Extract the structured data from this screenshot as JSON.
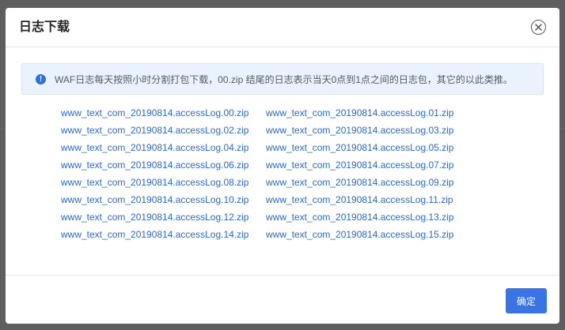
{
  "dialog": {
    "title": "日志下载",
    "close_icon": "close-circle-icon",
    "notice": {
      "icon": "info-icon",
      "icon_glyph": "!",
      "text": "WAF日志每天按照小时分割打包下载，00.zip 结尾的日志表示当天0点到1点之间的日志包，其它的以此类推。"
    },
    "files": [
      "www_text_com_20190814.accessLog.00.zip",
      "www_text_com_20190814.accessLog.01.zip",
      "www_text_com_20190814.accessLog.02.zip",
      "www_text_com_20190814.accessLog.03.zip",
      "www_text_com_20190814.accessLog.04.zip",
      "www_text_com_20190814.accessLog.05.zip",
      "www_text_com_20190814.accessLog.06.zip",
      "www_text_com_20190814.accessLog.07.zip",
      "www_text_com_20190814.accessLog.08.zip",
      "www_text_com_20190814.accessLog.09.zip",
      "www_text_com_20190814.accessLog.10.zip",
      "www_text_com_20190814.accessLog.11.zip",
      "www_text_com_20190814.accessLog.12.zip",
      "www_text_com_20190814.accessLog.13.zip",
      "www_text_com_20190814.accessLog.14.zip",
      "www_text_com_20190814.accessLog.15.zip"
    ],
    "confirm_label": "确定"
  },
  "colors": {
    "accent": "#3a73e6",
    "link": "#2c67d3",
    "notice_bg": "#eaf3fd",
    "overlay": "#5e5e5e"
  }
}
